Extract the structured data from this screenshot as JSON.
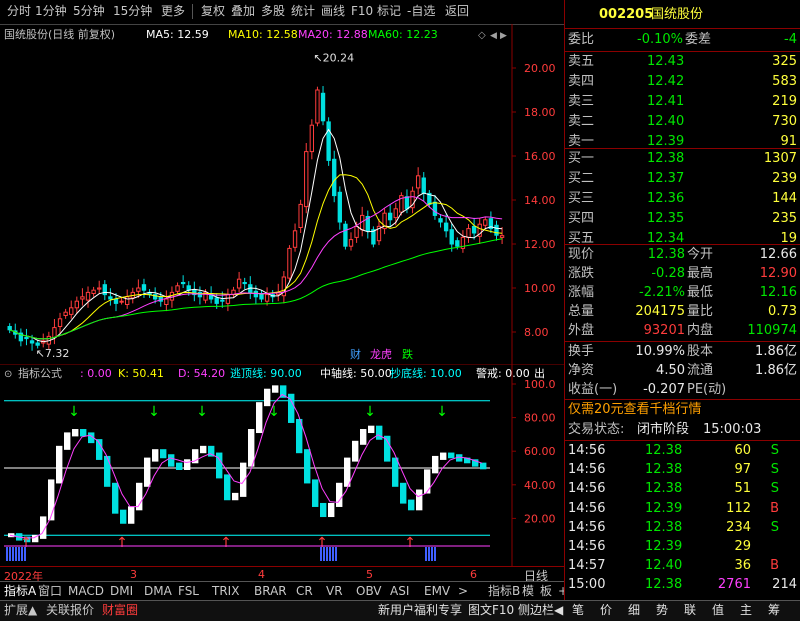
{
  "toolbar": {
    "items": [
      "分时",
      "1分钟",
      "5分钟",
      "15分钟",
      "更多",
      "复权",
      "叠加",
      "多股",
      "统计",
      "画线",
      "F10",
      "标记",
      "-自选",
      "返回"
    ]
  },
  "kline": {
    "title": "国统股份(日线 前复权)",
    "ma": [
      {
        "label": "MA5: 12.59",
        "color": "#ffffff"
      },
      {
        "label": "MA10: 12.58",
        "color": "#ffff00"
      },
      {
        "label": "MA20: 12.88",
        "color": "#ff40ff"
      },
      {
        "label": "MA60: 12.23",
        "color": "#00ff00"
      }
    ],
    "y_ticks": [
      "20.00",
      "18.00",
      "16.00",
      "14.00",
      "12.00",
      "10.00",
      "8.00"
    ],
    "high_label": "20.24",
    "low_label": "7.32",
    "badges": [
      {
        "text": "财",
        "color": "#40a0ff"
      },
      {
        "text": "龙虎",
        "color": "#ff40ff"
      },
      {
        "text": "跌",
        "color": "#00ff00"
      }
    ]
  },
  "indicator": {
    "params": [
      {
        "label": "指标公式",
        "color": "#c0c0c0"
      },
      {
        "label": ": 0.00",
        "color": "#ff40ff"
      },
      {
        "label": "K: 50.41",
        "color": "#ffff00"
      },
      {
        "label": "D: 54.20",
        "color": "#ff40ff"
      },
      {
        "label": "逃顶线: 90.00",
        "color": "#00ffff"
      },
      {
        "label": "中轴线: 50.00",
        "color": "#ffffff"
      },
      {
        "label": "抄底线: 10.00",
        "color": "#00ffff"
      },
      {
        "label": "警戒: 0.00",
        "color": "#ffffff"
      },
      {
        "label": "出",
        "color": "#ffffff"
      }
    ],
    "y_ticks": [
      "100.0",
      "80.00",
      "60.00",
      "40.00",
      "20.00"
    ]
  },
  "chart_data": {
    "type": "candlestick",
    "title": "国统股份(日线 前复权)",
    "x_labels": [
      "2022年",
      "3",
      "4",
      "5",
      "6"
    ],
    "y_ticks": [
      8,
      10,
      12,
      14,
      16,
      18,
      20
    ],
    "ylim": [
      7,
      21
    ],
    "high_mark": 20.24,
    "low_mark": 7.32,
    "close_series": [
      8.1,
      7.9,
      7.6,
      7.7,
      7.5,
      7.4,
      7.6,
      7.8,
      8.2,
      8.6,
      8.9,
      9.1,
      9.4,
      9.6,
      9.8,
      9.9,
      10.0,
      9.7,
      9.5,
      9.3,
      9.4,
      9.6,
      9.8,
      10.0,
      9.9,
      9.7,
      9.5,
      9.4,
      9.5,
      9.8,
      10.1,
      10.2,
      9.9,
      9.7,
      9.6,
      9.8,
      9.5,
      9.3,
      9.4,
      9.7,
      9.9,
      10.4,
      10.2,
      9.8,
      9.6,
      9.5,
      9.7,
      9.6,
      9.8,
      10.5,
      11.8,
      12.6,
      13.8,
      16.2,
      17.4,
      19.0,
      17.6,
      15.8,
      14.2,
      13.0,
      11.9,
      12.2,
      12.8,
      13.3,
      12.6,
      12.0,
      12.8,
      13.4,
      13.1,
      13.6,
      14.2,
      13.6,
      14.4,
      15.1,
      14.3,
      13.8,
      13.3,
      13.0,
      12.6,
      12.0,
      11.9,
      12.3,
      12.7,
      12.5,
      12.9,
      13.1,
      12.7,
      12.4,
      12.38
    ],
    "ma_series": [
      "MA5",
      "MA10",
      "MA20",
      "MA60"
    ],
    "indicator": {
      "name": "指标公式",
      "lines": {
        "逃顶线": 90,
        "中轴线": 50,
        "抄底线": 10
      },
      "K": 50.41,
      "D": 54.2,
      "ylim": [
        0,
        100
      ],
      "k_series": [
        10,
        8,
        7,
        9,
        20,
        42,
        62,
        70,
        72,
        70,
        66,
        56,
        40,
        24,
        18,
        26,
        40,
        55,
        60,
        57,
        52,
        50,
        54,
        60,
        62,
        58,
        45,
        32,
        34,
        52,
        72,
        88,
        96,
        98,
        93,
        78,
        60,
        42,
        28,
        22,
        28,
        40,
        55,
        65,
        72,
        74,
        68,
        55,
        40,
        30,
        26,
        36,
        48,
        56,
        58,
        57,
        55,
        54,
        52,
        50.41
      ]
    }
  },
  "timeline": {
    "labels": [
      "2022年",
      "3",
      "4",
      "5",
      "6"
    ],
    "right_label": "日线"
  },
  "indicator_tabs": [
    "指标A",
    "窗口",
    "MACD",
    "DMI",
    "DMA",
    "FSL",
    "TRIX",
    "BRAR",
    "CR",
    "VR",
    "OBV",
    "ASI",
    "EMV",
    ">",
    "指标B",
    "模",
    "板",
    "+",
    "-"
  ],
  "bottom_bar": {
    "left": [
      "扩展▲",
      "关联报价",
      "财富圈"
    ],
    "center": [
      "新用户福利专享",
      "图文F10",
      "侧边栏◀"
    ],
    "right": [
      "笔",
      "价",
      "细",
      "势",
      "联",
      "值",
      "主",
      "筹"
    ]
  },
  "quote": {
    "code": "002205",
    "name": "国统股份",
    "webi": {
      "label": "委比",
      "value": "-0.10%",
      "label2": "委差",
      "value2": "-4"
    },
    "asks": [
      {
        "label": "卖五",
        "price": "12.43",
        "vol": "325"
      },
      {
        "label": "卖四",
        "price": "12.42",
        "vol": "583"
      },
      {
        "label": "卖三",
        "price": "12.41",
        "vol": "219"
      },
      {
        "label": "卖二",
        "price": "12.40",
        "vol": "730"
      },
      {
        "label": "卖一",
        "price": "12.39",
        "vol": "91"
      }
    ],
    "bids": [
      {
        "label": "买一",
        "price": "12.38",
        "vol": "1307"
      },
      {
        "label": "买二",
        "price": "12.37",
        "vol": "239"
      },
      {
        "label": "买三",
        "price": "12.36",
        "vol": "144"
      },
      {
        "label": "买四",
        "price": "12.35",
        "vol": "235"
      },
      {
        "label": "买五",
        "price": "12.34",
        "vol": "19"
      }
    ],
    "stats": [
      {
        "l1": "现价",
        "v1": "12.38",
        "c1": "green",
        "l2": "今开",
        "v2": "12.66",
        "c2": "white"
      },
      {
        "l1": "涨跌",
        "v1": "-0.28",
        "c1": "green",
        "l2": "最高",
        "v2": "12.90",
        "c2": "red"
      },
      {
        "l1": "涨幅",
        "v1": "-2.21%",
        "c1": "green",
        "l2": "最低",
        "v2": "12.16",
        "c2": "green"
      },
      {
        "l1": "总量",
        "v1": "204175",
        "c1": "yellow",
        "l2": "量比",
        "v2": "0.73",
        "c2": "yellow"
      },
      {
        "l1": "外盘",
        "v1": "93201",
        "c1": "red",
        "l2": "内盘",
        "v2": "110974",
        "c2": "green"
      }
    ],
    "stats2": [
      {
        "l1": "换手",
        "v1": "10.99%",
        "c1": "white",
        "l2": "股本",
        "v2": "1.86亿",
        "c2": "white"
      },
      {
        "l1": "净资",
        "v1": "4.50",
        "c1": "white",
        "l2": "流通",
        "v2": "1.86亿",
        "c2": "white"
      },
      {
        "l1": "收益(一)",
        "v1": "-0.207",
        "c1": "white",
        "l2": "PE(动)",
        "v2": "",
        "c2": "white"
      }
    ],
    "ad": "仅需20元查看千档行情",
    "trade_status_label": "交易状态:",
    "trade_status": "闭市阶段",
    "trade_time": "15:00:03",
    "ticks": [
      {
        "time": "14:56",
        "price": "12.38",
        "pc": "green",
        "vol": "60",
        "vc": "yellow",
        "bs": "S",
        "bc": "green"
      },
      {
        "time": "14:56",
        "price": "12.38",
        "pc": "green",
        "vol": "97",
        "vc": "yellow",
        "bs": "S",
        "bc": "green"
      },
      {
        "time": "14:56",
        "price": "12.38",
        "pc": "green",
        "vol": "51",
        "vc": "yellow",
        "bs": "S",
        "bc": "green"
      },
      {
        "time": "14:56",
        "price": "12.39",
        "pc": "green",
        "vol": "112",
        "vc": "yellow",
        "bs": "B",
        "bc": "red"
      },
      {
        "time": "14:56",
        "price": "12.38",
        "pc": "green",
        "vol": "234",
        "vc": "yellow",
        "bs": "S",
        "bc": "green"
      },
      {
        "time": "14:56",
        "price": "12.39",
        "pc": "green",
        "vol": "29",
        "vc": "yellow",
        "bs": "",
        "bc": "green"
      },
      {
        "time": "14:57",
        "price": "12.40",
        "pc": "green",
        "vol": "36",
        "vc": "yellow",
        "bs": "B",
        "bc": "red"
      },
      {
        "time": "15:00",
        "price": "12.38",
        "pc": "green",
        "vol": "2761",
        "vc": "mag",
        "bs": "214",
        "bc": "white"
      }
    ]
  }
}
